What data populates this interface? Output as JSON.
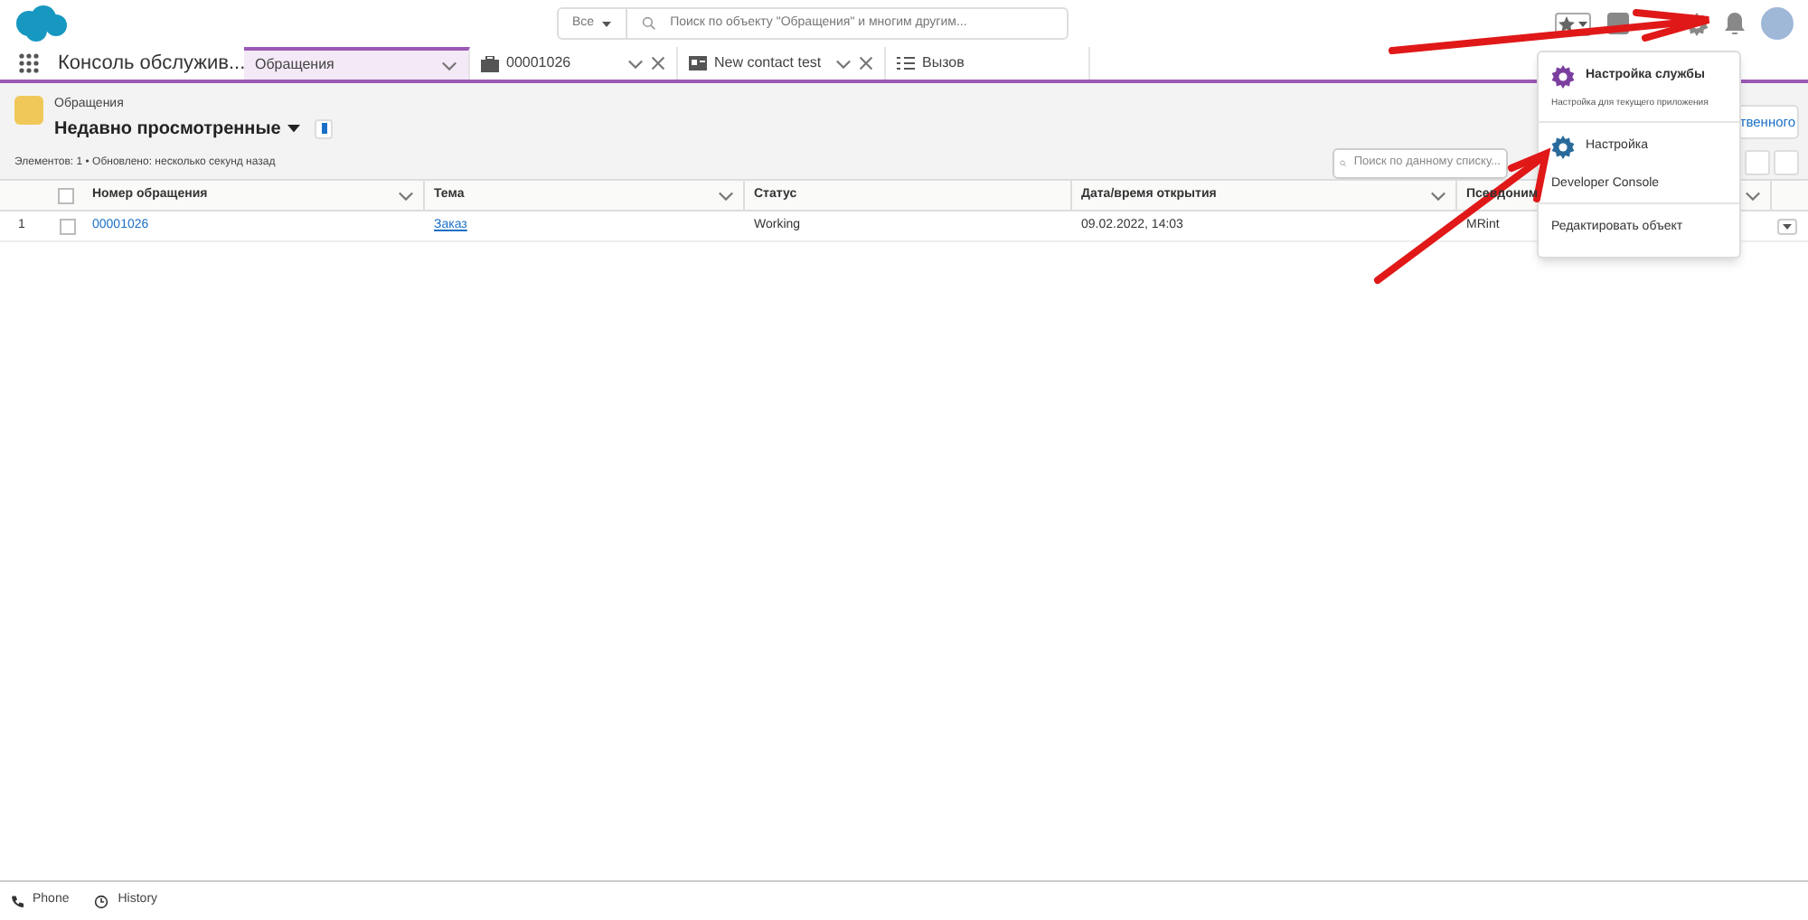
{
  "header": {
    "scope": "Все",
    "search_placeholder": "Поиск по объекту \"Обращения\" и многим другим..."
  },
  "app_name": "Консоль обслужив...",
  "tabs": [
    {
      "label": "Обращения",
      "selected": true,
      "kind": "list"
    },
    {
      "label": "00001026",
      "selected": false,
      "kind": "case"
    },
    {
      "label": "New contact test",
      "selected": false,
      "kind": "contact"
    },
    {
      "label": "Вызов",
      "selected": false,
      "kind": "call"
    }
  ],
  "list_header": {
    "object": "Обращения",
    "view": "Недавно просмотренные",
    "meta": "Элементов: 1 • Обновлено: несколько секунд назад",
    "button_fragment": "твенного",
    "search_placeholder": "Поиск по данному списку..."
  },
  "table": {
    "all_checked": false,
    "columns": [
      "Номер обращения",
      "Тема",
      "Статус",
      "Дата/время открытия",
      "Псевдоним"
    ],
    "rows": [
      {
        "index": "1",
        "checked": false,
        "cells": [
          "00001026",
          "Заказ",
          "Working",
          "09.02.2022, 14:03",
          "MRint"
        ]
      }
    ]
  },
  "setup_menu": {
    "items": [
      {
        "kind": "service",
        "label": "Настройка службы",
        "description": "Настройка для текущего приложения"
      },
      {
        "kind": "setup",
        "label": "Настройка"
      },
      {
        "kind": "plain",
        "label": "Developer Console"
      },
      {
        "kind": "divider-plain",
        "label": "Редактировать объект"
      }
    ]
  },
  "utility_bar": [
    {
      "kind": "phone",
      "label": "Phone"
    },
    {
      "kind": "history",
      "label": "History"
    }
  ]
}
